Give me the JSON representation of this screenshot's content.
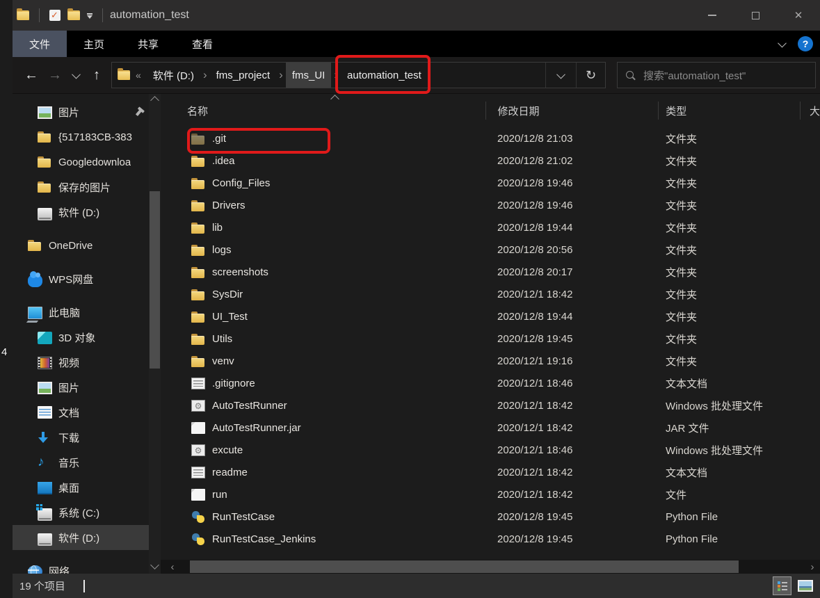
{
  "colors": {
    "annotation": "#e01a1a",
    "accent_blue": "#1573cf",
    "folder_yellow": "#e8bf55"
  },
  "icons": {
    "back": "←",
    "forward": "→",
    "up": "↑",
    "refresh": "↻",
    "overflow": "«",
    "crumb_sep": "›",
    "hscroll_left": "‹",
    "hscroll_right": "›",
    "close": "✕"
  },
  "desktop": {
    "fragment_label": "4"
  },
  "titlebar": {
    "title": "automation_test"
  },
  "ribbon": {
    "tabs": [
      {
        "label": "文件",
        "active": true
      },
      {
        "label": "主页"
      },
      {
        "label": "共享"
      },
      {
        "label": "查看"
      }
    ],
    "help_glyph": "?"
  },
  "navbar": {
    "breadcrumb": {
      "segments": [
        {
          "label": "软件 (D:)"
        },
        {
          "label": "fms_project"
        },
        {
          "label": "fms_UI",
          "hover": true
        },
        {
          "label": "automation_test",
          "annotated": true
        }
      ]
    },
    "search": {
      "placeholder": "搜索\"automation_test\""
    }
  },
  "sidebar": {
    "items": [
      {
        "label": "图片",
        "icon": "picture-icon",
        "indent": 2,
        "pinned": true
      },
      {
        "label": "{517183CB-383",
        "icon": "folder-icon",
        "indent": 2
      },
      {
        "label": "Googledownloa",
        "icon": "folder-icon",
        "indent": 2
      },
      {
        "label": "保存的图片",
        "icon": "folder-icon",
        "indent": 2
      },
      {
        "label": "软件 (D:)",
        "icon": "drive-icon",
        "indent": 2
      },
      {
        "label": "OneDrive",
        "icon": "folder-icon",
        "indent": 1,
        "group": true
      },
      {
        "label": "WPS网盘",
        "icon": "cloud-icon",
        "indent": 1,
        "group": true
      },
      {
        "label": "此电脑",
        "icon": "computer-icon",
        "indent": 1,
        "group": true
      },
      {
        "label": "3D 对象",
        "icon": "cube-icon",
        "indent": 2
      },
      {
        "label": "视频",
        "icon": "film-icon",
        "indent": 2
      },
      {
        "label": "图片",
        "icon": "picture-icon",
        "indent": 2
      },
      {
        "label": "文档",
        "icon": "doc-icon",
        "indent": 2
      },
      {
        "label": "下载",
        "icon": "download-icon",
        "indent": 2
      },
      {
        "label": "音乐",
        "icon": "music-icon",
        "indent": 2
      },
      {
        "label": "桌面",
        "icon": "desktop-icon",
        "indent": 2
      },
      {
        "label": "系统 (C:)",
        "icon": "drivewin-icon",
        "indent": 2
      },
      {
        "label": "软件 (D:)",
        "icon": "drive-icon",
        "indent": 2,
        "selected": true
      },
      {
        "label": "网络",
        "icon": "network-icon",
        "indent": 1,
        "group": true
      }
    ]
  },
  "filelist": {
    "columns": {
      "name": "名称",
      "date": "修改日期",
      "type": "类型",
      "size": "大"
    },
    "rows": [
      {
        "name": ".git",
        "date": "2020/12/8 21:03",
        "type": "文件夹",
        "icon": "folder-icon",
        "dimmed": true,
        "annotated": true
      },
      {
        "name": ".idea",
        "date": "2020/12/8 21:02",
        "type": "文件夹",
        "icon": "folder-icon"
      },
      {
        "name": "Config_Files",
        "date": "2020/12/8 19:46",
        "type": "文件夹",
        "icon": "folder-icon"
      },
      {
        "name": "Drivers",
        "date": "2020/12/8 19:46",
        "type": "文件夹",
        "icon": "folder-icon"
      },
      {
        "name": "lib",
        "date": "2020/12/8 19:44",
        "type": "文件夹",
        "icon": "folder-icon"
      },
      {
        "name": "logs",
        "date": "2020/12/8 20:56",
        "type": "文件夹",
        "icon": "folder-icon"
      },
      {
        "name": "screenshots",
        "date": "2020/12/8 20:17",
        "type": "文件夹",
        "icon": "folder-icon"
      },
      {
        "name": "SysDir",
        "date": "2020/12/1 18:42",
        "type": "文件夹",
        "icon": "folder-icon"
      },
      {
        "name": "UI_Test",
        "date": "2020/12/8 19:44",
        "type": "文件夹",
        "icon": "folder-icon"
      },
      {
        "name": "Utils",
        "date": "2020/12/8 19:45",
        "type": "文件夹",
        "icon": "folder-icon"
      },
      {
        "name": "venv",
        "date": "2020/12/1 19:16",
        "type": "文件夹",
        "icon": "folder-icon"
      },
      {
        "name": ".gitignore",
        "date": "2020/12/1 18:46",
        "type": "文本文档",
        "icon": "text-icon"
      },
      {
        "name": "AutoTestRunner",
        "date": "2020/12/1 18:42",
        "type": "Windows 批处理文件",
        "icon": "batch-icon"
      },
      {
        "name": "AutoTestRunner.jar",
        "date": "2020/12/1 18:42",
        "type": "JAR 文件",
        "icon": "file-icon"
      },
      {
        "name": "excute",
        "date": "2020/12/1 18:46",
        "type": "Windows 批处理文件",
        "icon": "batch-icon"
      },
      {
        "name": "readme",
        "date": "2020/12/1 18:42",
        "type": "文本文档",
        "icon": "text-icon"
      },
      {
        "name": "run",
        "date": "2020/12/1 18:42",
        "type": "文件",
        "icon": "file-icon"
      },
      {
        "name": "RunTestCase",
        "date": "2020/12/8 19:45",
        "type": "Python File",
        "icon": "python-icon"
      },
      {
        "name": "RunTestCase_Jenkins",
        "date": "2020/12/8 19:45",
        "type": "Python File",
        "icon": "python-icon"
      }
    ]
  },
  "statusbar": {
    "count_label": "19 个项目"
  }
}
